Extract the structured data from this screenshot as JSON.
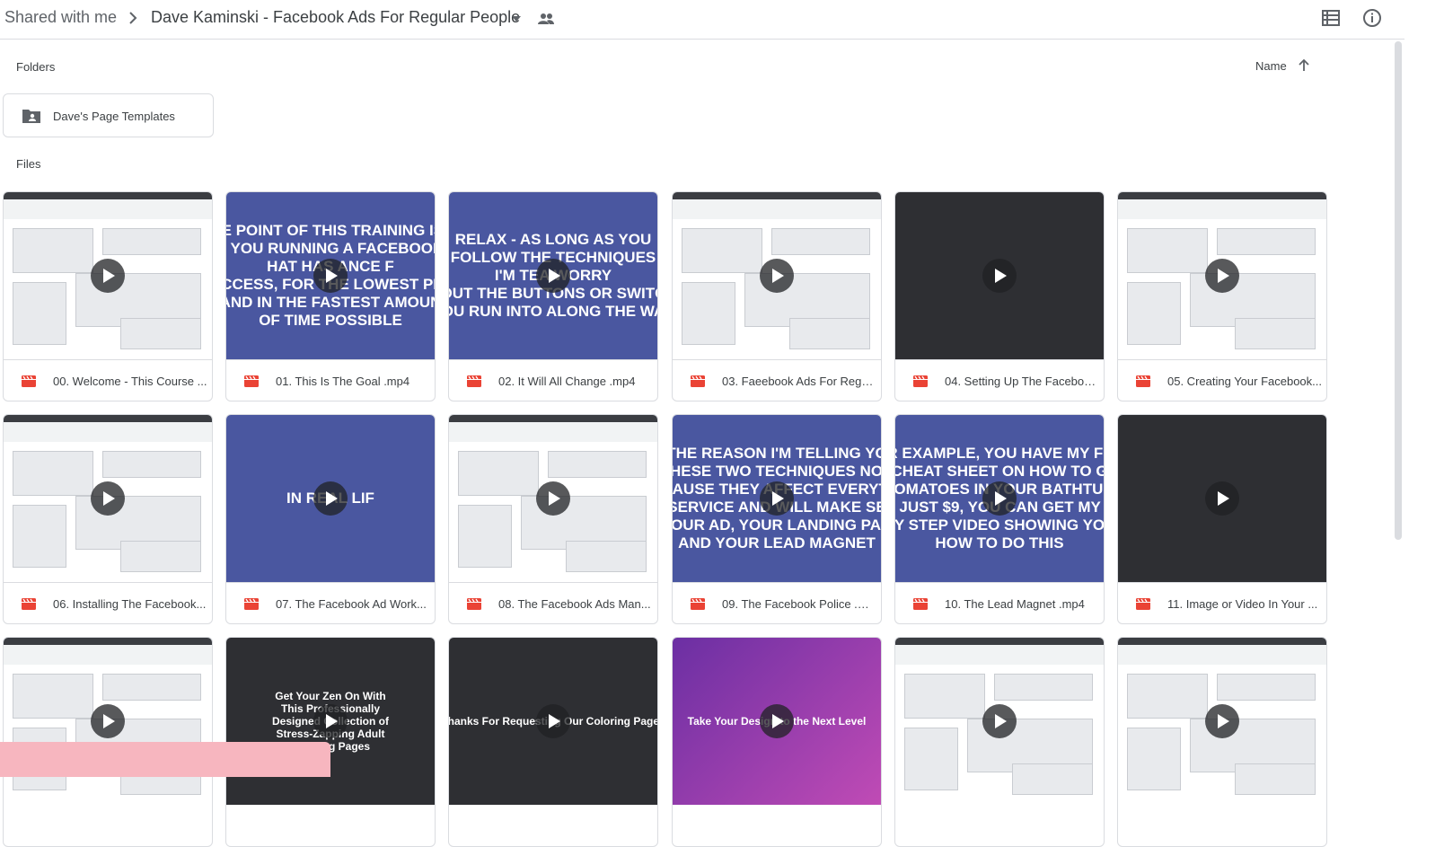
{
  "breadcrumb": {
    "root": "Shared with me",
    "current": "Dave Kaminski - Facebook Ads For Regular People"
  },
  "icons": {
    "separator": "chevron-right-icon",
    "caret": "caret-down-icon",
    "shared": "people-icon",
    "list_view": "list-view-icon",
    "info": "info-icon",
    "sort": "arrow-up-icon",
    "folder": "shared-folder-icon",
    "video": "video-file-icon",
    "play": "play-icon"
  },
  "sections": {
    "folders": "Folders",
    "files": "Files"
  },
  "sort": {
    "label": "Name"
  },
  "folders": [
    {
      "name": "Dave's Page Templates"
    }
  ],
  "files": [
    {
      "name": "00. Welcome - This Course ...",
      "thumb": "screen",
      "overlay": ""
    },
    {
      "name": "01. This Is The Goal .mp4",
      "thumb": "blue",
      "overlay": "IE POINT OF THIS TRAINING IS\nT YOU RUNNING A FACEBOOK\nHAT HAS ANCE F\nICCESS, FOR THE LOWEST PR\nAND IN THE FASTEST AMOUN\nOF TIME POSSIBLE"
    },
    {
      "name": "02. It Will All Change .mp4",
      "thumb": "blue",
      "overlay": "RELAX - AS LONG AS YOU\nFOLLOW THE TECHNIQUES\nI'M TEA WORRY\nOUT THE BUTTONS OR SWITC\nOU RUN INTO ALONG THE WA"
    },
    {
      "name": "03. Faeebook Ads For Regu...",
      "thumb": "screen",
      "overlay": ""
    },
    {
      "name": "04. Setting Up The Faceboo...",
      "thumb": "dark",
      "overlay": ""
    },
    {
      "name": "05. Creating Your Facebook...",
      "thumb": "screen",
      "overlay": ""
    },
    {
      "name": "06. Installing The Facebook...",
      "thumb": "screen",
      "overlay": ""
    },
    {
      "name": "07. The Facebook Ad Work...",
      "thumb": "blue",
      "overlay": "IN REAL LIF"
    },
    {
      "name": "08. The Facebook Ads Man...",
      "thumb": "screen",
      "overlay": ""
    },
    {
      "name": "09. The Facebook Police .m...",
      "thumb": "blue",
      "overlay": "THE REASON I'M TELLING YO\nTHESE TWO TECHNIQUES NOV\nCAUSE THEY AFFECT EVERYTI\nSERVICE AND WILL MAKE SE\nYOUR AD, YOUR LANDING PAG\nAND YOUR LEAD MAGNET"
    },
    {
      "name": "10. The Lead Magnet .mp4",
      "thumb": "blue",
      "overlay": "R EXAMPLE, YOU HAVE MY FF\nCHEAT SHEET ON HOW TO G\nTOMATOES IN YOUR BATHTUB\nR JUST $9, YOU CAN GET MY S\nBY STEP VIDEO SHOWING YOU\nHOW TO DO THIS"
    },
    {
      "name": "11. Image or Video In Your ...",
      "thumb": "dark",
      "overlay": ""
    },
    {
      "name": "",
      "thumb": "screen",
      "overlay": ""
    },
    {
      "name": "",
      "thumb": "dark",
      "overlay": "Get Your Zen On With\nThis Professionally\nDesigned Collection of\nStress-Zapping Adult\nColoring Pages"
    },
    {
      "name": "",
      "thumb": "dark",
      "overlay": "Thanks For Requesting Our Coloring Pages"
    },
    {
      "name": "",
      "thumb": "purple",
      "overlay": "Take Your Design to the Next Level"
    },
    {
      "name": "",
      "thumb": "screen",
      "overlay": ""
    },
    {
      "name": "",
      "thumb": "screen",
      "overlay": ""
    }
  ],
  "colors": {
    "video_icon": "#ea4335",
    "text": "#3c4043",
    "border": "#dadce0",
    "blue_slide": "#4a57a0"
  }
}
